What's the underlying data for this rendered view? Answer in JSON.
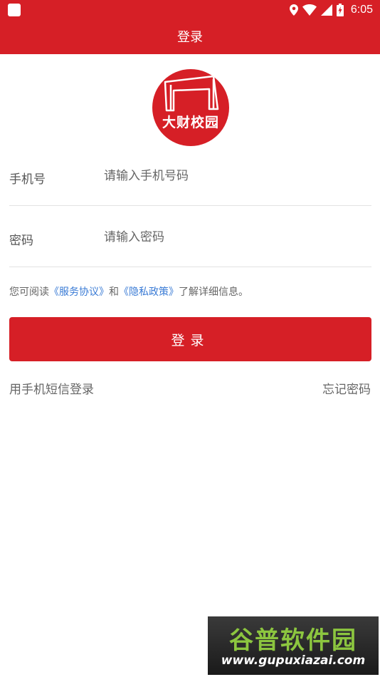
{
  "status_bar": {
    "time": "6:05",
    "icons": [
      "app-icon",
      "location-icon",
      "wifi-icon",
      "signal-icon",
      "battery-icon"
    ]
  },
  "header": {
    "title": "登录"
  },
  "logo": {
    "text": "大财校园"
  },
  "form": {
    "phone": {
      "label": "手机号",
      "placeholder": "请输入手机号码",
      "value": ""
    },
    "password": {
      "label": "密码",
      "placeholder": "请输入密码",
      "value": ""
    }
  },
  "agreement": {
    "prefix": "您可阅读",
    "service_link": "《服务协议》",
    "and": "和",
    "privacy_link": "《隐私政策》",
    "suffix": "了解详细信息。"
  },
  "login_button": {
    "label": "登录"
  },
  "footer_links": {
    "sms_login": "用手机短信登录",
    "forgot_password": "忘记密码"
  },
  "watermark": {
    "brand": "谷普软件园",
    "url": "www.gupuxiazai.com"
  },
  "colors": {
    "brand_red": "#d61f26",
    "link_blue": "#3a7bd5"
  }
}
